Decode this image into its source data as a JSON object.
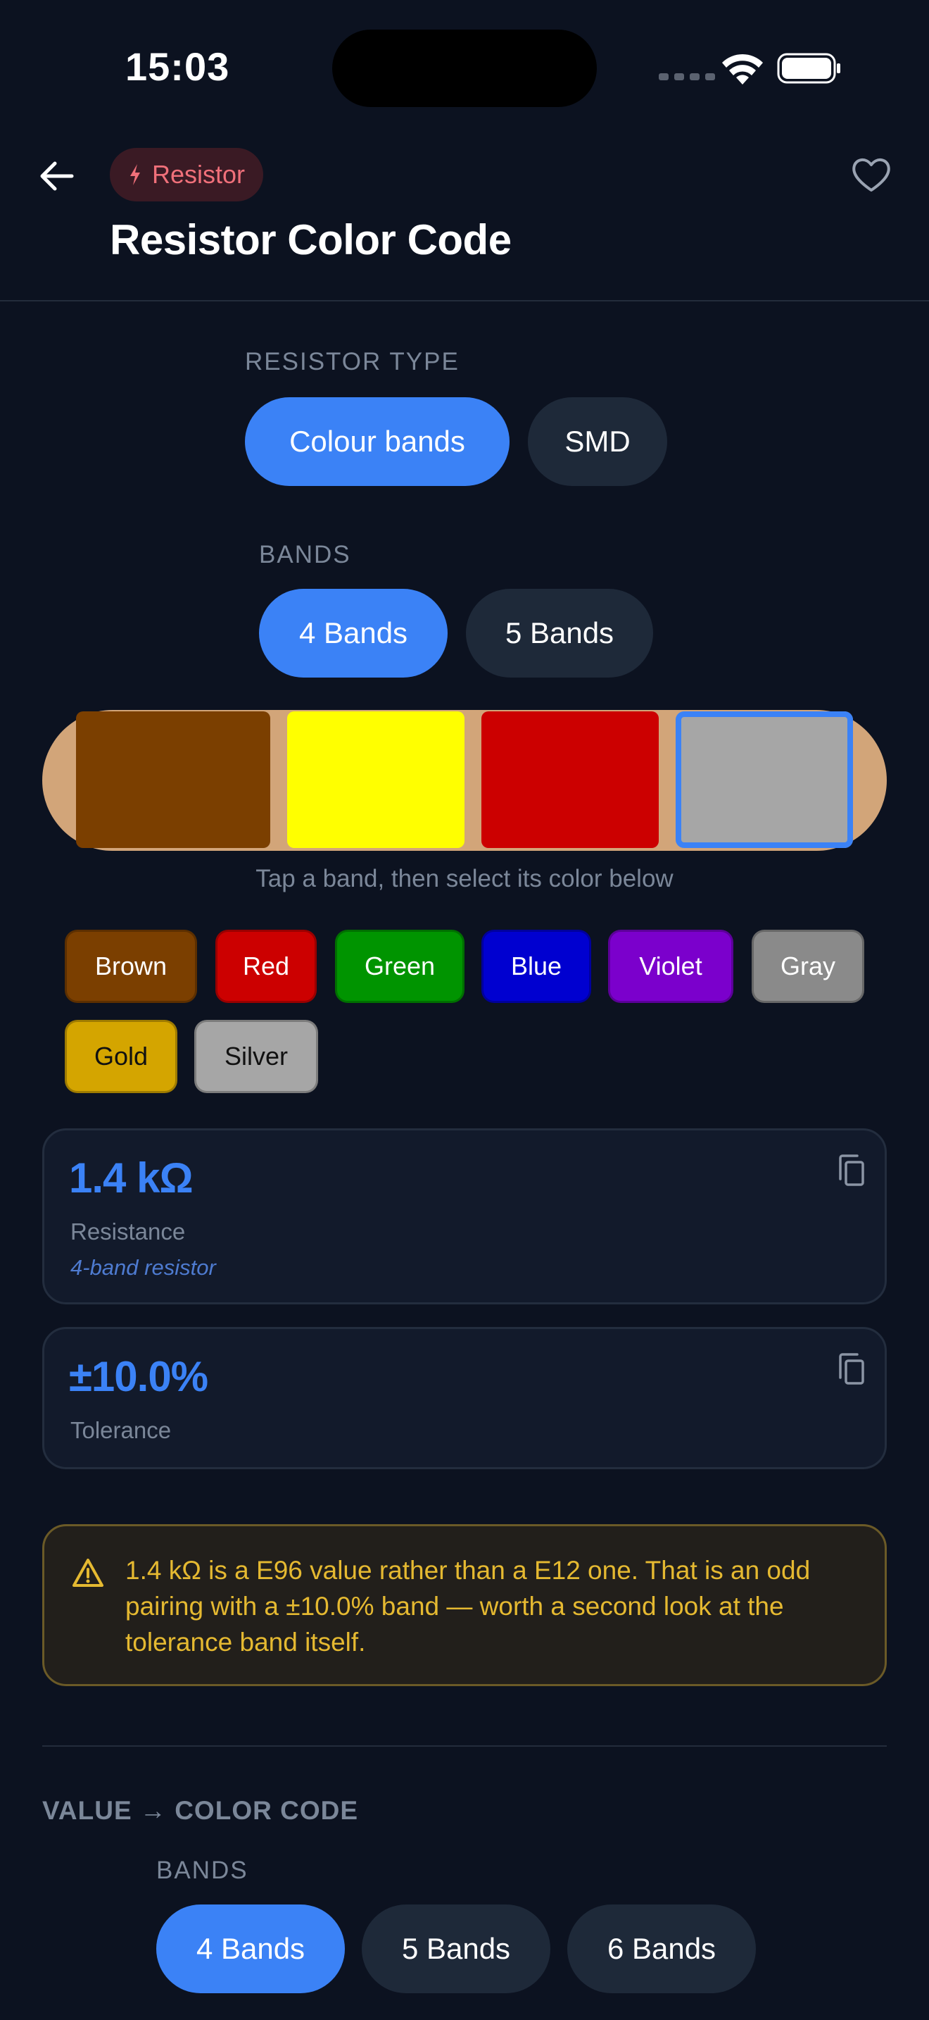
{
  "status": {
    "time": "15:03"
  },
  "header": {
    "chip_label": "Resistor",
    "title": "Resistor Color Code"
  },
  "resistor_type": {
    "label": "RESISTOR TYPE",
    "options": [
      "Colour bands",
      "SMD"
    ],
    "selected": "Colour bands"
  },
  "bands": {
    "label": "BANDS",
    "options": [
      "4 Bands",
      "5 Bands"
    ],
    "selected": "4 Bands"
  },
  "resistor": {
    "band_colors": [
      "#7b3f00",
      "#ffff00",
      "#cc0000",
      "#a6a6a6"
    ],
    "selected_band": 4,
    "hint": "Tap a band, then select its color below"
  },
  "palette": [
    {
      "label": "Brown",
      "color": "#7b3f00",
      "text": "#ffffff"
    },
    {
      "label": "Red",
      "color": "#cc0000",
      "text": "#ffffff"
    },
    {
      "label": "Green",
      "color": "#009400",
      "text": "#ffffff"
    },
    {
      "label": "Blue",
      "color": "#0000d0",
      "text": "#ffffff"
    },
    {
      "label": "Violet",
      "color": "#7b00cc",
      "text": "#ffffff"
    },
    {
      "label": "Gray",
      "color": "#8a8a8a",
      "text": "#ffffff"
    },
    {
      "label": "Gold",
      "color": "#d4a500",
      "text": "#111111"
    },
    {
      "label": "Silver",
      "color": "#a6a6a6",
      "text": "#111111"
    }
  ],
  "resistance": {
    "value": "1.4 kΩ",
    "label": "Resistance",
    "note": "4-band resistor"
  },
  "tolerance": {
    "value": "±10.0%",
    "label": "Tolerance"
  },
  "warning": {
    "text": "1.4 kΩ is a E96 value rather than a E12 one. That is an odd pairing with a ±10.0% band — worth a second look at the tolerance band itself."
  },
  "value_to_code": {
    "heading": "VALUE → COLOR CODE",
    "bands_label": "BANDS",
    "options": [
      "4 Bands",
      "5 Bands",
      "6 Bands"
    ],
    "selected": "4 Bands"
  },
  "colors": {
    "accent": "#3b82f6",
    "background": "#0c1220",
    "warning": "#e5b931",
    "resistor_body": "#d2a579"
  }
}
